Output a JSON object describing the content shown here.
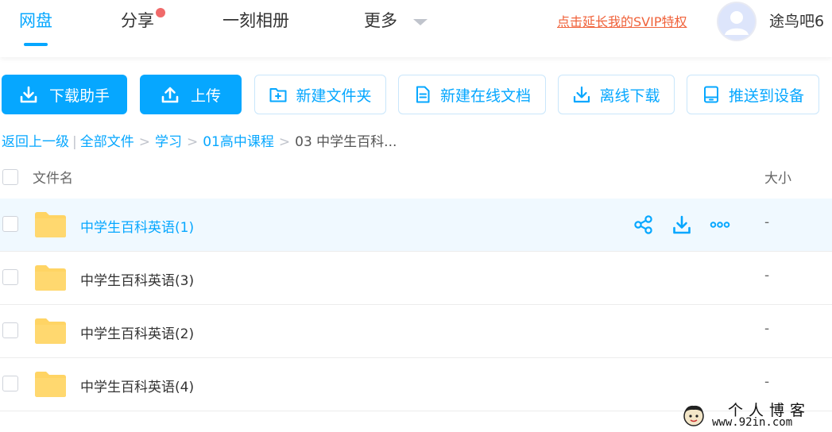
{
  "nav": {
    "tabs": [
      {
        "label": "网盘",
        "active": true
      },
      {
        "label": "分享",
        "has_dot": true
      },
      {
        "label": "一刻相册"
      },
      {
        "label": "更多",
        "has_caret": true
      }
    ],
    "svip_link": "点击延长我的SVIP特权",
    "username": "途鸟吧6"
  },
  "toolbar": {
    "download_helper": "下载助手",
    "upload": "上传",
    "new_folder": "新建文件夹",
    "new_online_doc": "新建在线文档",
    "offline_download": "离线下载",
    "push_to_device": "推送到设备"
  },
  "breadcrumb": {
    "back": "返回上一级",
    "separator_bar": "|",
    "items": [
      "全部文件",
      "学习",
      "01高中课程"
    ],
    "separator": ">",
    "current": "03 中学生百科..."
  },
  "table": {
    "columns": {
      "name": "文件名",
      "size": "大小"
    },
    "rows": [
      {
        "name": "中学生百科英语(1)",
        "size": "-",
        "hovered": true
      },
      {
        "name": "中学生百科英语(3)",
        "size": "-"
      },
      {
        "name": "中学生百科英语(2)",
        "size": "-"
      },
      {
        "name": "中学生百科英语(4)",
        "size": "-"
      }
    ]
  },
  "watermark": {
    "title": "个人博客",
    "url": "www.92in.com"
  },
  "colors": {
    "accent": "#06a7ff",
    "svip": "#f0623a",
    "folder": "#ffd464",
    "hover_row": "#f0f9ff"
  }
}
